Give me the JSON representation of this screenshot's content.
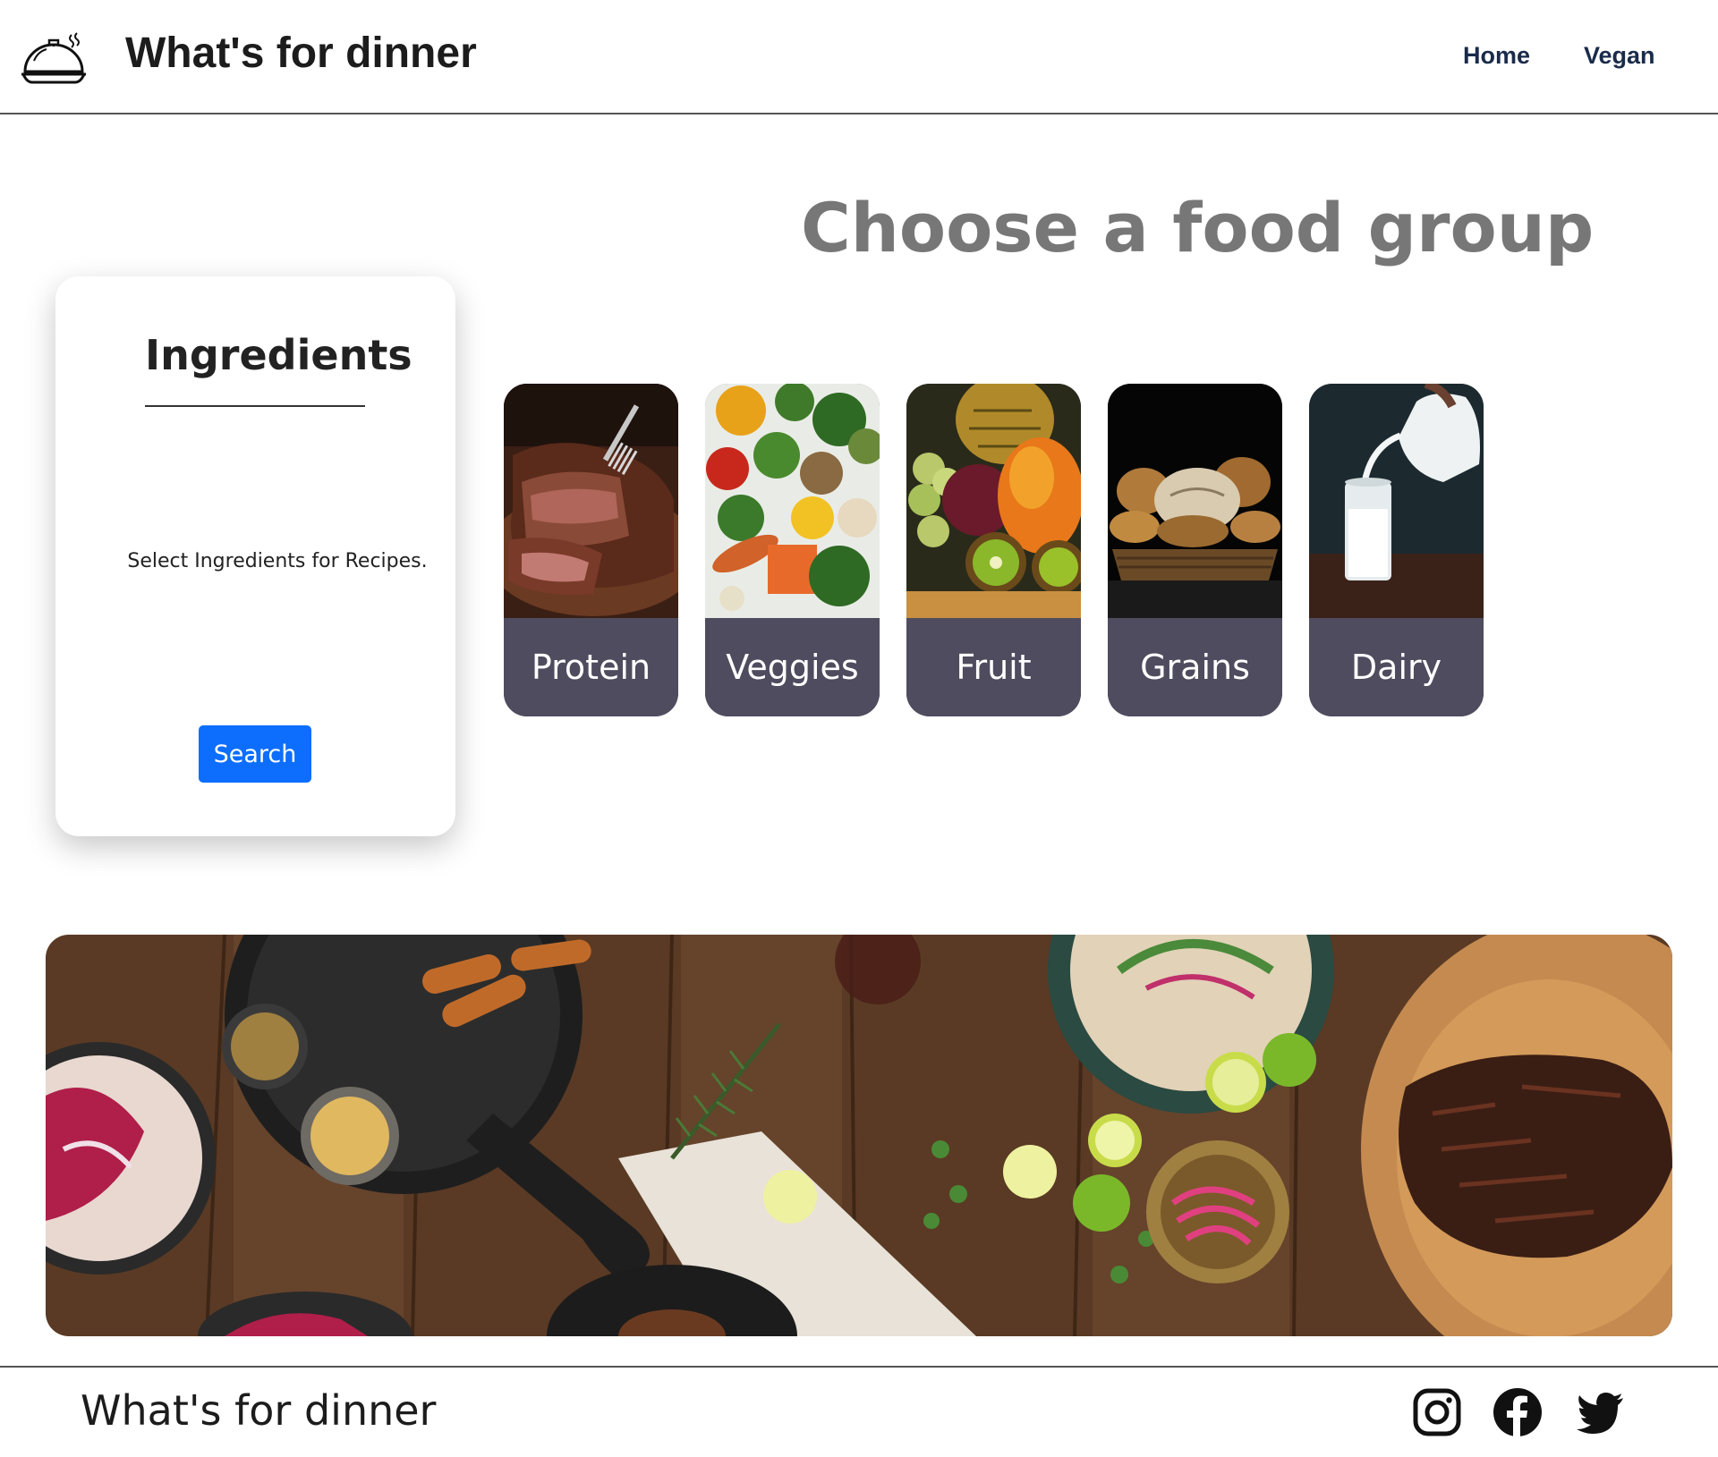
{
  "header": {
    "brand": "What's for dinner",
    "nav": {
      "home": "Home",
      "vegan": "Vegan"
    }
  },
  "main": {
    "title": "Choose a food group",
    "ingredients": {
      "title": "Ingredients",
      "hint": "Select Ingredients for Recipes.",
      "search_label": "Search"
    },
    "food_groups": [
      {
        "label": "Protein"
      },
      {
        "label": "Veggies"
      },
      {
        "label": "Fruit"
      },
      {
        "label": "Grains"
      },
      {
        "label": "Dairy"
      }
    ]
  },
  "footer": {
    "brand": "What's for dinner",
    "social": [
      "instagram-icon",
      "facebook-icon",
      "twitter-icon"
    ]
  },
  "colors": {
    "accent": "#0d6efd",
    "card_label_bg": "#4e4c5e",
    "title_grey": "#777777",
    "nav_text": "#1a2b4a"
  }
}
